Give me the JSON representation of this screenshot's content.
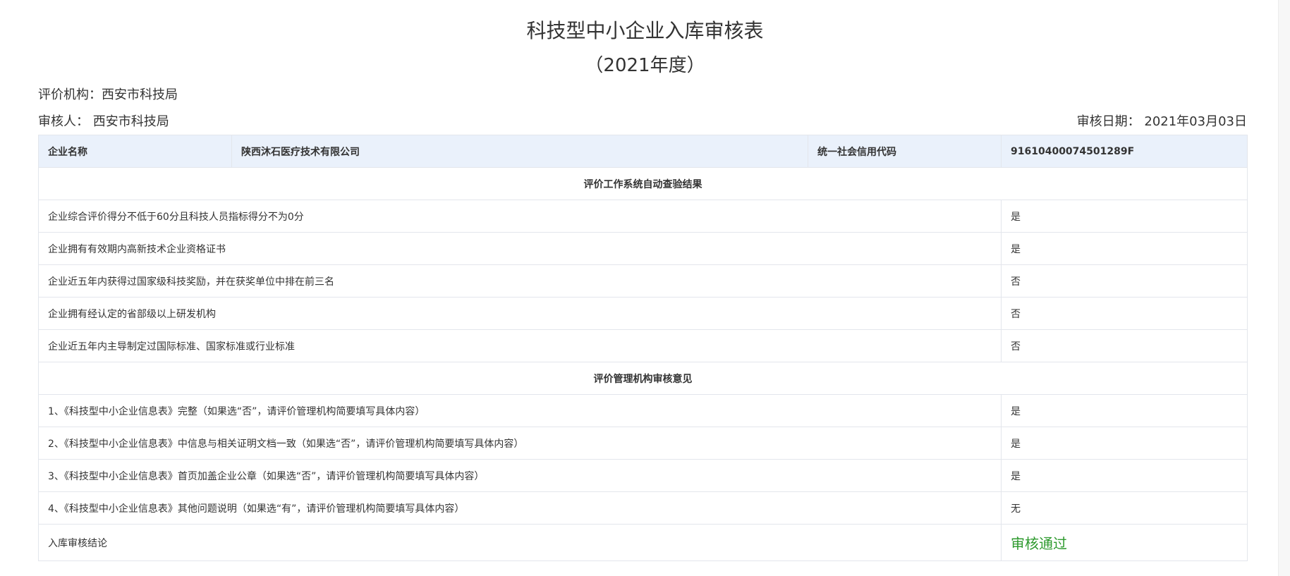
{
  "header": {
    "title": "科技型中小企业入库审核表",
    "subtitle": "（2021年度）"
  },
  "meta": {
    "org_label": "评价机构：",
    "org_value": "西安市科技局",
    "reviewer_label": "审核人：",
    "reviewer_value": "西安市科技局",
    "date_label": "审核日期：",
    "date_value": "2021年03月03日"
  },
  "company": {
    "name_label": "企业名称",
    "name_value": "陕西沐石医疗技术有限公司",
    "code_label": "统一社会信用代码",
    "code_value": "91610400074501289F"
  },
  "auto_check": {
    "heading": "评价工作系统自动查验结果",
    "rows": [
      {
        "item": "企业综合评价得分不低于60分且科技人员指标得分不为0分",
        "result": "是"
      },
      {
        "item": "企业拥有有效期内高新技术企业资格证书",
        "result": "是"
      },
      {
        "item": "企业近五年内获得过国家级科技奖励，并在获奖单位中排在前三名",
        "result": "否"
      },
      {
        "item": "企业拥有经认定的省部级以上研发机构",
        "result": "否"
      },
      {
        "item": "企业近五年内主导制定过国际标准、国家标准或行业标准",
        "result": "否"
      }
    ]
  },
  "management_review": {
    "heading": "评价管理机构审核意见",
    "rows": [
      {
        "item": "1、《科技型中小企业信息表》完整（如果选“否”，请评价管理机构简要填写具体内容）",
        "result": "是"
      },
      {
        "item": "2、《科技型中小企业信息表》中信息与相关证明文档一致（如果选“否”，请评价管理机构简要填写具体内容）",
        "result": "是"
      },
      {
        "item": "3、《科技型中小企业信息表》首页加盖企业公章（如果选“否”，请评价管理机构简要填写具体内容）",
        "result": "是"
      },
      {
        "item": "4、《科技型中小企业信息表》其他问题说明（如果选“有”，请评价管理机构简要填写具体内容）",
        "result": "无"
      }
    ]
  },
  "conclusion": {
    "label": "入库审核结论",
    "value": "审核通过",
    "value_color": "#2e9a2e"
  },
  "colors": {
    "header_bg": "#eaf1fb",
    "border": "#e3e6ec",
    "text": "#333333"
  }
}
